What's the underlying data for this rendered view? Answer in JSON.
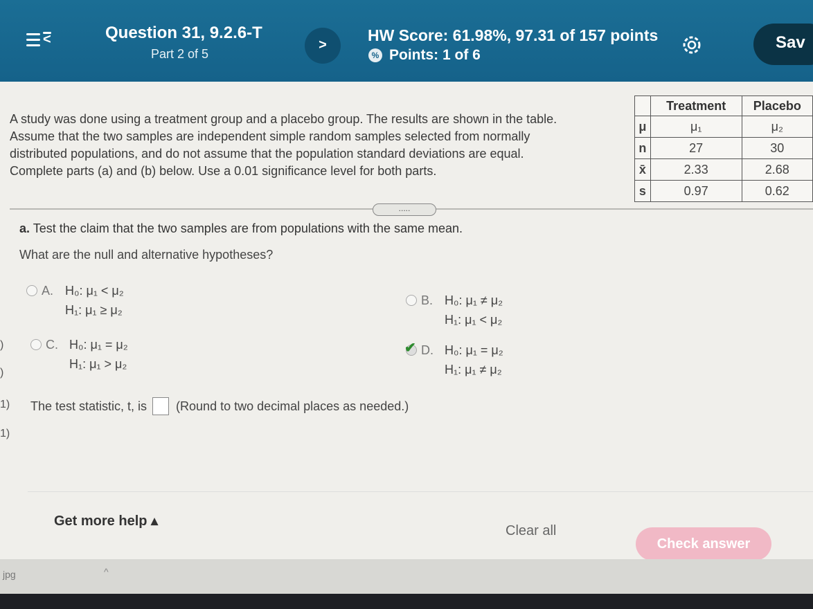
{
  "header": {
    "question_title": "Question 31, 9.2.6-T",
    "part": "Part 2 of 5",
    "hw_score": "HW Score: 61.98%, 97.31 of 157 points",
    "points": "Points: 1 of 6",
    "save_label": "Sav",
    "next_glyph": ">",
    "menu_glyph": "<"
  },
  "problem_text": [
    "A study was done using a treatment group and a placebo group. The results are shown in the table.",
    "Assume that the two samples are independent simple random samples selected from normally",
    "distributed populations, and do not assume that the population standard deviations are equal.",
    "Complete parts (a) and (b) below. Use a 0.01 significance level for both parts."
  ],
  "table": {
    "headers": [
      "Treatment",
      "Placebo"
    ],
    "rows": [
      {
        "label": "μ",
        "treatment": "μ₁",
        "placebo": "μ₂"
      },
      {
        "label": "n",
        "treatment": "27",
        "placebo": "30"
      },
      {
        "label": "x̄",
        "treatment": "2.33",
        "placebo": "2.68"
      },
      {
        "label": "s",
        "treatment": "0.97",
        "placebo": "0.62"
      }
    ]
  },
  "more_pill": ".....",
  "part_a": {
    "label": "a.",
    "text": "Test the claim that the two samples are from populations with the same mean.",
    "prompt": "What are the null and alternative hypotheses?"
  },
  "options": [
    {
      "letter": "A.",
      "h0": "H₀: μ₁ < μ₂",
      "h1": "H₁: μ₁ ≥ μ₂",
      "selected": false
    },
    {
      "letter": "B.",
      "h0": "H₀: μ₁ ≠ μ₂",
      "h1": "H₁: μ₁ < μ₂",
      "selected": false
    },
    {
      "letter": "C.",
      "h0": "H₀: μ₁ = μ₂",
      "h1": "H₁: μ₁ > μ₂",
      "selected": false
    },
    {
      "letter": "D.",
      "h0": "H₀: μ₁ = μ₂",
      "h1": "H₁: μ₁ ≠ μ₂",
      "selected": true
    }
  ],
  "test_statistic": {
    "before": "The test statistic, t, is",
    "after": "(Round to two decimal places as needed.)",
    "value": ""
  },
  "footer_actions": {
    "help": "Get more help ▴",
    "clear": "Clear all",
    "check": "Check answer"
  },
  "left_edge": [
    ")",
    ")",
    "1)",
    "1)"
  ],
  "file_label": "jpg",
  "caret": "^",
  "colors": {
    "header": "#15628a",
    "check_button": "#f1b9c6",
    "correct_check": "#2e8b2e"
  }
}
